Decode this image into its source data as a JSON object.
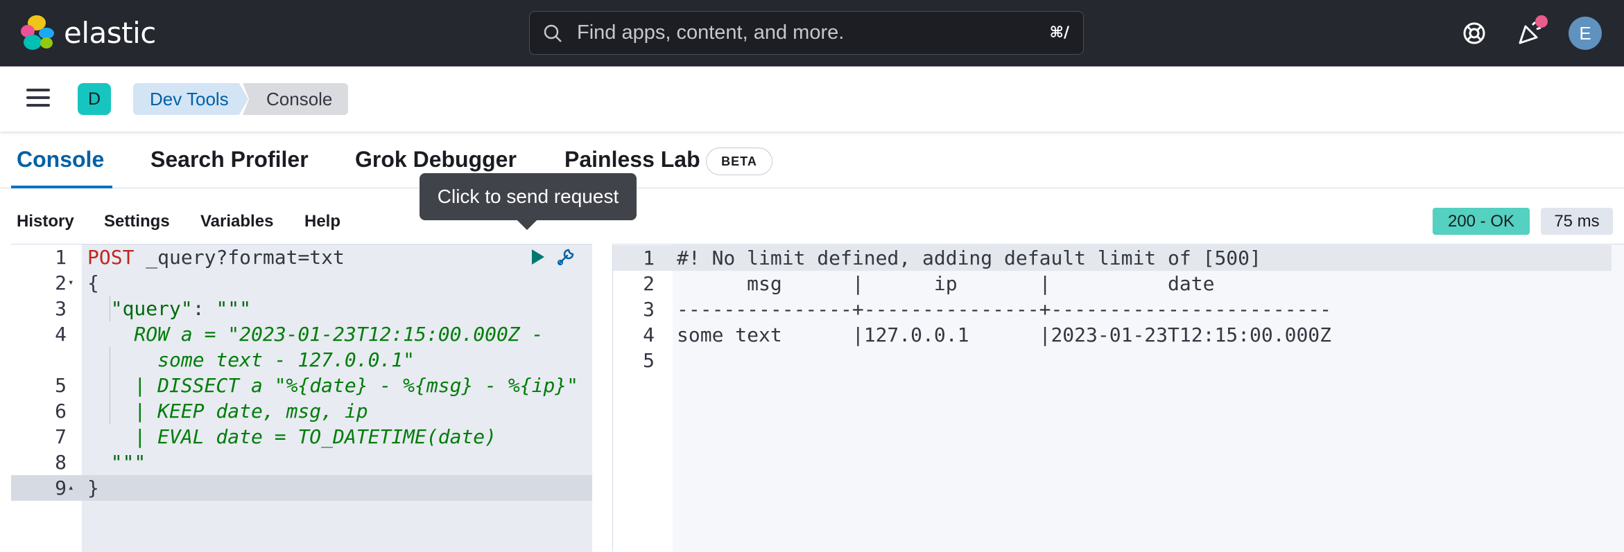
{
  "header": {
    "logo_text": "elastic",
    "search_placeholder": "Find apps, content, and more.",
    "search_shortcut": "⌘/",
    "avatar_initial": "E",
    "colors": {
      "bg": "#25282f",
      "notification": "#e75d8c",
      "avatar": "#6092c0"
    }
  },
  "subheader": {
    "space_initial": "D",
    "breadcrumbs": [
      "Dev Tools",
      "Console"
    ]
  },
  "tabs": [
    {
      "label": "Console",
      "active": true
    },
    {
      "label": "Search Profiler"
    },
    {
      "label": "Grok Debugger"
    },
    {
      "label": "Painless Lab",
      "badge": "BETA"
    }
  ],
  "toolbar": {
    "items": [
      "History",
      "Settings",
      "Variables",
      "Help"
    ],
    "status": "200 - OK",
    "duration": "75 ms"
  },
  "tooltip": "Click to send request",
  "editor": {
    "lines": [
      {
        "n": "1",
        "parts": [
          [
            "kw",
            "POST"
          ],
          [
            "url",
            " _query?format=txt"
          ]
        ]
      },
      {
        "n": "2",
        "fold": "▾",
        "parts": [
          [
            "punc",
            "{"
          ]
        ]
      },
      {
        "n": "3",
        "parts": [
          [
            "str",
            "  \"query\""
          ],
          [
            "punc",
            ": "
          ],
          [
            "str",
            "\"\"\""
          ]
        ]
      },
      {
        "n": "4",
        "parts": [
          [
            "esql",
            "    ROW a = \"2023-01-23T12:15:00.000Z -"
          ]
        ]
      },
      {
        "n": "",
        "parts": [
          [
            "esql",
            "      some text - 127.0.0.1\""
          ]
        ]
      },
      {
        "n": "5",
        "parts": [
          [
            "esql",
            "    | DISSECT a \"%{date} - %{msg} - %{ip}\""
          ]
        ]
      },
      {
        "n": "6",
        "parts": [
          [
            "esql",
            "    | KEEP date, msg, ip"
          ]
        ]
      },
      {
        "n": "7",
        "parts": [
          [
            "esql",
            "    | EVAL date = TO_DATETIME(date)"
          ]
        ]
      },
      {
        "n": "8",
        "parts": [
          [
            "str",
            "  \"\"\""
          ]
        ]
      },
      {
        "n": "9",
        "fold": "▴",
        "parts": [
          [
            "punc",
            "}"
          ]
        ]
      }
    ]
  },
  "output": {
    "lines": [
      {
        "n": "1",
        "text": "#! No limit defined, adding default limit of [500]"
      },
      {
        "n": "2",
        "text": "      msg      |      ip       |          date          "
      },
      {
        "n": "3",
        "text": "---------------+---------------+------------------------"
      },
      {
        "n": "4",
        "text": "some text      |127.0.0.1      |2023-01-23T12:15:00.000Z"
      },
      {
        "n": "5",
        "text": ""
      }
    ]
  }
}
